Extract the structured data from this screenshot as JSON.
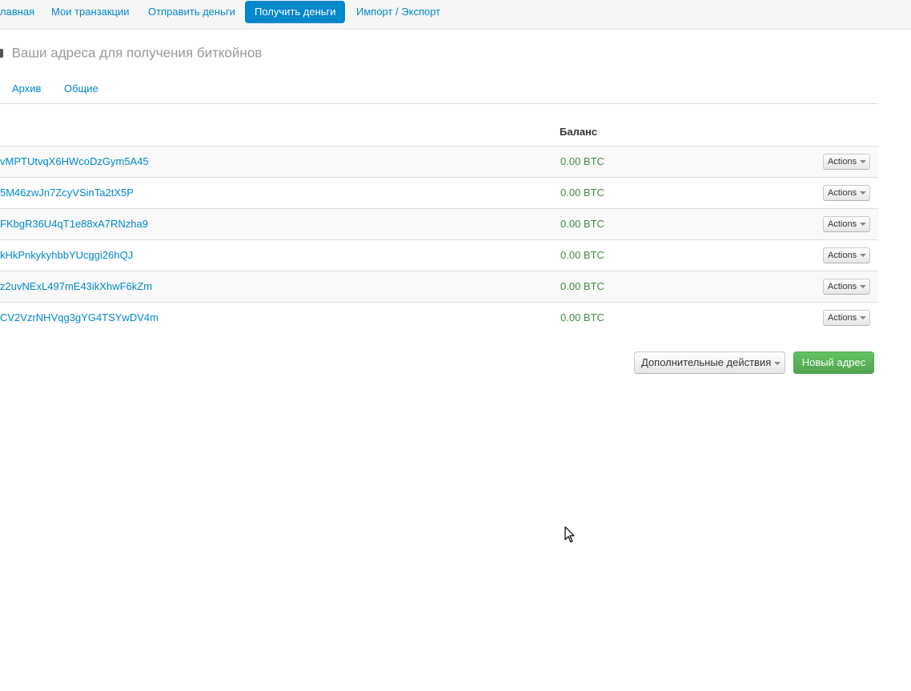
{
  "nav": {
    "items": [
      {
        "label": "лавная",
        "active": false
      },
      {
        "label": "Мои транзакции",
        "active": false
      },
      {
        "label": "Отправить деньги",
        "active": false
      },
      {
        "label": "Получить деньги",
        "active": true
      },
      {
        "label": "Импорт / Экспорт",
        "active": false
      }
    ]
  },
  "page": {
    "title": "Ваши адреса для получения биткойнов"
  },
  "subtabs": [
    {
      "label": "Архив"
    },
    {
      "label": "Общие"
    }
  ],
  "table": {
    "balance_header": "Баланс",
    "rows": [
      {
        "address": "vMPTUtvqX6HWcoDzGym5A45",
        "balance": "0.00 BTC",
        "actions_label": "Actions"
      },
      {
        "address": "5M46zwJn7ZcyVSinTa2tX5P",
        "balance": "0.00 BTC",
        "actions_label": "Actions"
      },
      {
        "address": "FKbgR36U4qT1e88xA7RNzha9",
        "balance": "0.00 BTC",
        "actions_label": "Actions"
      },
      {
        "address": "kHkPnkykyhbbYUcggi26hQJ",
        "balance": "0.00 BTC",
        "actions_label": "Actions"
      },
      {
        "address": "z2uvNExL497mE43ikXhwF6kZm",
        "balance": "0.00 BTC",
        "actions_label": "Actions"
      },
      {
        "address": "CV2VzrNHVqg3gYG4TSYwDV4m",
        "balance": "0.00 BTC",
        "actions_label": "Actions"
      }
    ]
  },
  "buttons": {
    "more_actions": "Дополнительные действия",
    "new_address": "Новый адрес"
  },
  "icons": {
    "caret": "caret-down-icon",
    "cursor": "mouse-pointer-icon"
  },
  "colors": {
    "link": "#0088cc",
    "active_tab": "#0088cc",
    "balance": "#468847",
    "primary_green": "#5bb75b"
  }
}
